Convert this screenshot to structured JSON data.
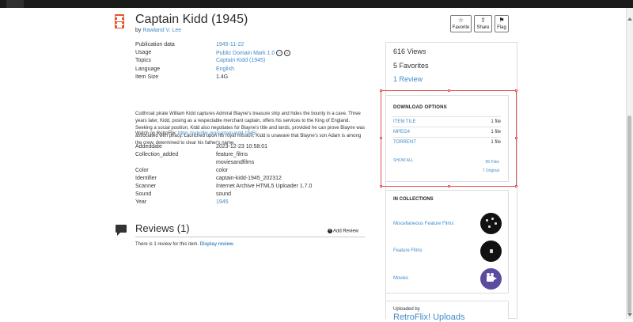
{
  "item": {
    "title": "Captain Kidd (1945)",
    "by_label": "by",
    "creator": "Rawland V. Lee"
  },
  "actions": {
    "favorite_label": "Favorite",
    "share_label": "Share",
    "flag_label": "Flag"
  },
  "metadata_top": [
    {
      "key": "Publication data",
      "value": "1945-11-22",
      "link": true
    },
    {
      "key": "Usage",
      "value": "Public Domain Mark 1.0",
      "link": true
    },
    {
      "key": "Topics",
      "value": "Captain Kidd (1945)",
      "link": true
    },
    {
      "key": "Language",
      "value": "English",
      "link": true
    },
    {
      "key": "Item Size",
      "value": "1.4G",
      "link": false
    }
  ],
  "description": "Cutthroat pirate William Kidd captures Admiral Blayne's treasure ship and hides the bounty in a cave. Three years later, Kidd, posing as a respectable merchant captain, offers his services to the King of England. Seeking a social position, Kidd also negotiates for Blayne's title and lands, provided he can prove Blayne was associated with piracy. Launched upon his royal mission, Kidd is unaware that Blayne's son Adam is among the crew, determined to clear his father's name.",
  "watch_on": {
    "label": "Watch on RetroFlix:",
    "url": "https://retroflix.org/captain-kidd-1945/"
  },
  "metadata_bottom": [
    {
      "key": "Addeddate",
      "value": "2023-12-23 10:58:01",
      "link": false
    },
    {
      "key": "Collection_added",
      "value": "feature_films",
      "link": false
    },
    {
      "key": "",
      "value": "moviesandfilms",
      "link": false
    },
    {
      "key": "Color",
      "value": "color",
      "link": false
    },
    {
      "key": "Identifier",
      "value": "captain-kidd-1945_202312",
      "link": false
    },
    {
      "key": "Scanner",
      "value": "Internet Archive HTML5 Uploader 1.7.0",
      "link": false
    },
    {
      "key": "Sound",
      "value": "sound",
      "link": false
    },
    {
      "key": "Year",
      "value": "1945",
      "link": true
    }
  ],
  "reviews": {
    "title": "Reviews (1)",
    "add_label": "Add Review",
    "note_text": "There is 1 review for this item.",
    "note_link": "Display review."
  },
  "stats": {
    "views": "616 Views",
    "favorites": "5 Favorites",
    "reviews": "1 Review"
  },
  "downloads": {
    "heading": "DOWNLOAD OPTIONS",
    "options": [
      {
        "name": "ITEM TILE",
        "size": "1 file"
      },
      {
        "name": "MPEG4",
        "size": "1 file"
      },
      {
        "name": "TORRENT",
        "size": "1 file"
      }
    ],
    "show_all": "SHOW ALL",
    "files_count": "95 Files",
    "original_count": "7 Original"
  },
  "collections": {
    "heading": "IN COLLECTIONS",
    "items": [
      {
        "label": "Miscellaneous Feature Films"
      },
      {
        "label": "Feature Films"
      },
      {
        "label": "Movies"
      }
    ]
  },
  "uploaded": {
    "label": "Uploaded by",
    "uploader": "RetroFlix! Uploads"
  }
}
